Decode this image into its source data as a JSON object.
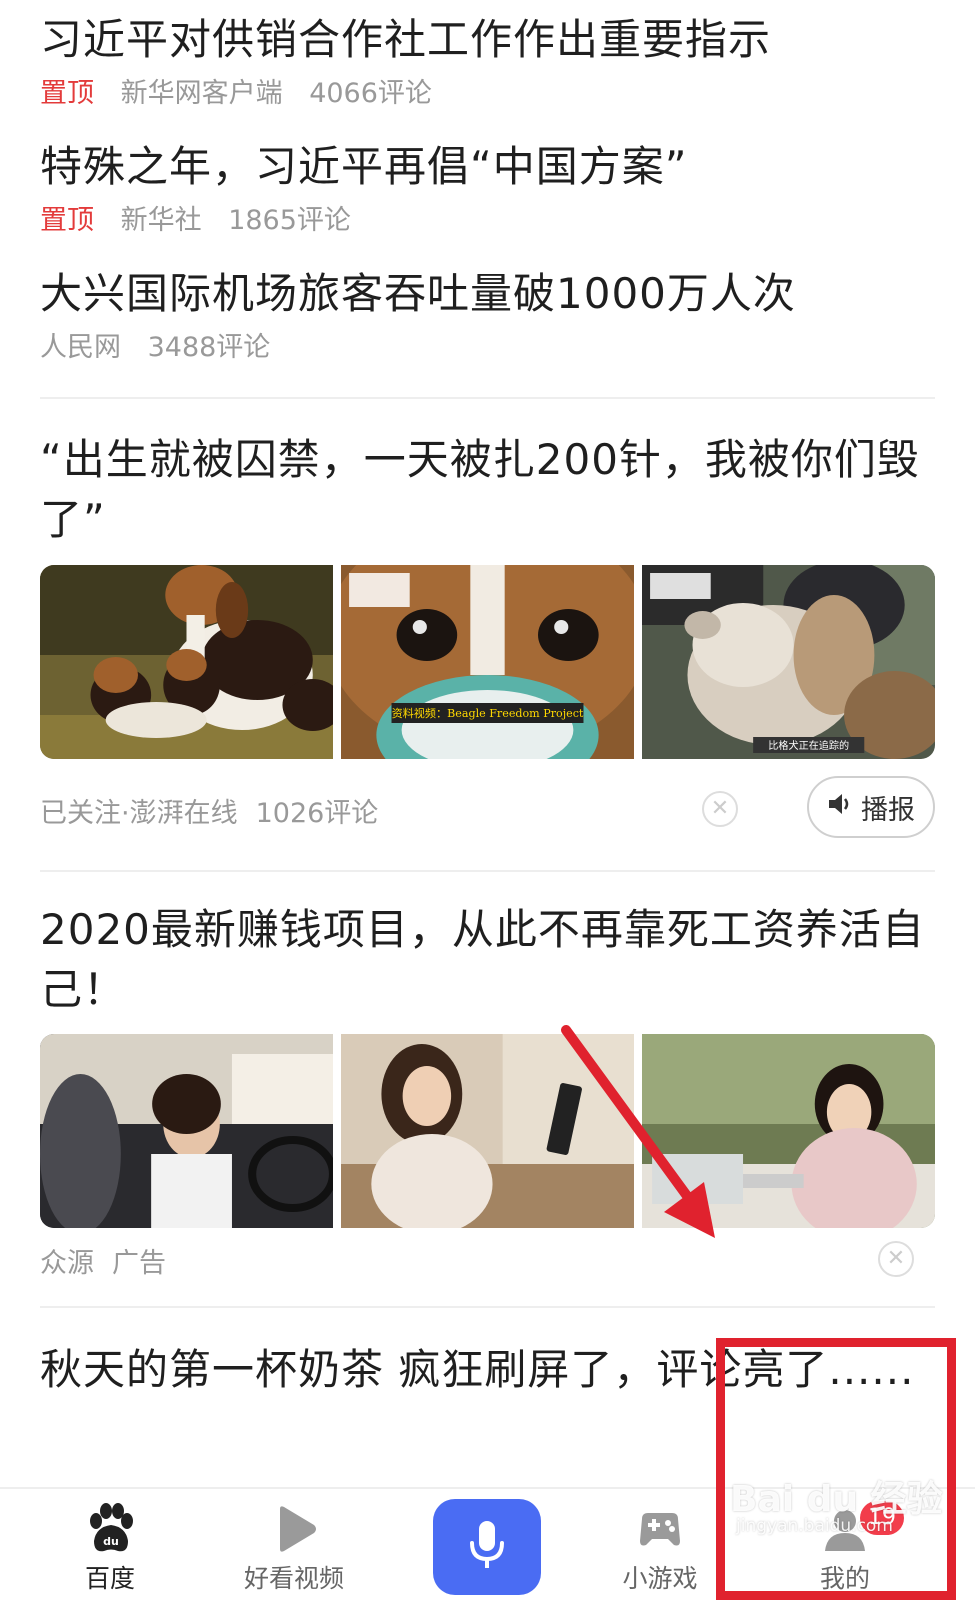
{
  "top_news": [
    {
      "title": "习近平对供销合作社工作作出重要指示",
      "pin": "置顶",
      "source": "新华网客户端",
      "comments": "4066评论"
    },
    {
      "title": "特殊之年，习近平再倡“中国方案”",
      "pin": "置顶",
      "source": "新华社",
      "comments": "1865评论"
    },
    {
      "title": "大兴国际机场旅客吞吐量破1000万人次",
      "pin": "",
      "source": "人民网",
      "comments": "3488评论"
    }
  ],
  "article1": {
    "title": "“出生就被囚禁，一天被扎200针，我被你们毁了”",
    "images": [
      "beagle-puppies-photo",
      "beagle-face-photo",
      "beagle-held-photo"
    ],
    "image_captions": [
      "",
      "资料视频：Beagle Freedom Project",
      "比格犬正在追踪的"
    ],
    "meta": "已关注·澎湃在线",
    "comments": "1026评论",
    "broadcast_label": "播报"
  },
  "article2": {
    "title": "2020最新赚钱项目，从此不再靠死工资养活自己！",
    "images": [
      "woman-in-car-photo",
      "woman-with-phone-photo",
      "woman-at-desk-photo"
    ],
    "source": "众源",
    "ad_label": "广告"
  },
  "article3": {
    "title": "秋天的第一杯奶茶 疯狂刷屏了，评论亮了......"
  },
  "bottom_nav": {
    "items": [
      {
        "label": "百度",
        "icon": "baidu-paw-icon"
      },
      {
        "label": "好看视频",
        "icon": "play-icon"
      },
      {
        "label": "",
        "icon": "microphone-icon"
      },
      {
        "label": "小游戏",
        "icon": "gamepad-icon"
      },
      {
        "label": "我的",
        "icon": "profile-icon"
      }
    ],
    "badge": "19"
  },
  "watermark": {
    "text": "Bai du 经验",
    "sub": "jingyan.baidu.com"
  },
  "colors": {
    "pin": "#e33b3b",
    "mic_button": "#4a6cf3",
    "badge": "#f23d4b",
    "annotation": "#e0222e"
  }
}
